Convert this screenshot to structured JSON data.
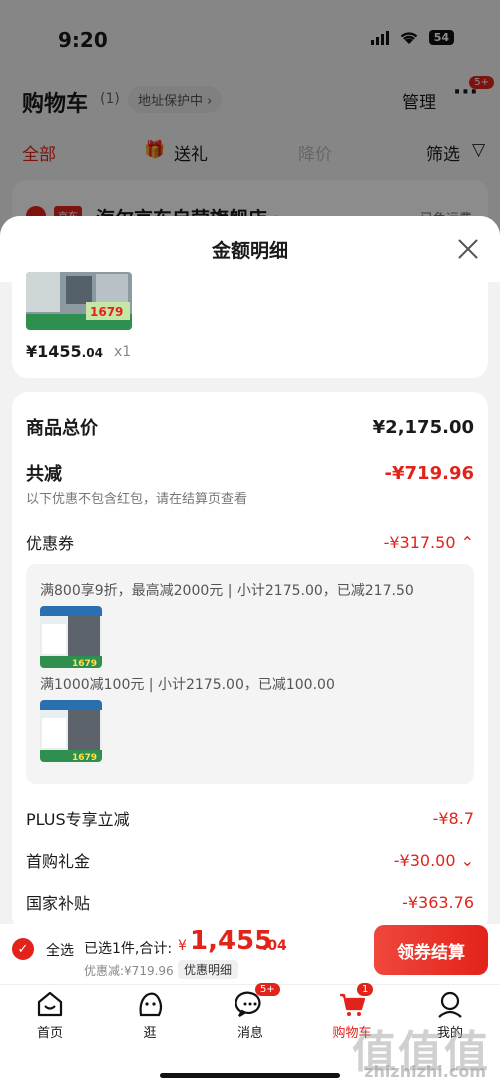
{
  "status_bar": {
    "time": "9:20",
    "battery": "54"
  },
  "background_page": {
    "title": "购物车",
    "count": "(1)",
    "address_protect": "地址保护中 ›",
    "manage": "管理",
    "more": "···",
    "more_badge": "5+",
    "tabs": {
      "all": "全部",
      "gift": "送礼",
      "discount": "降价",
      "filter": "筛选"
    },
    "store_tag": "京东",
    "store_name": "海尔京东自营旗舰店 ›",
    "shipping": "已免运费"
  },
  "sheet": {
    "title": "金额明细",
    "product": {
      "price_main": "¥1455",
      "price_dec": ".04",
      "qty": "x1"
    },
    "rows": {
      "total_label": "商品总价",
      "total_value": "¥2,175.00",
      "reduce_label": "共减",
      "reduce_value": "-¥719.96",
      "reduce_note": "以下优惠不包含红包，请在结算页查看",
      "coupon_label": "优惠券",
      "coupon_value": "-¥317.50 ⌃",
      "plus_label": "PLUS专享立减",
      "plus_value": "-¥8.7",
      "first_label": "首购礼金",
      "first_value": "-¥30.00 ⌄",
      "subsidy_label": "国家补贴",
      "subsidy_value": "-¥363.76"
    },
    "coupons": [
      {
        "text": "满800享9折，最高减2000元 | 小计2175.00，已减217.50"
      },
      {
        "text": "满1000减100元 | 小计2175.00，已减100.00"
      }
    ],
    "product_image_price": "1679"
  },
  "checkout": {
    "select_all": "全选",
    "selected": "已选1件,合计:",
    "yen": "¥",
    "total": "1,455",
    "total_dec": ".04",
    "saved": "优惠减:¥719.96",
    "detail_label": "优惠明细",
    "button": "领券结算"
  },
  "tabbar": {
    "home": "首页",
    "browse": "逛",
    "messages": "消息",
    "messages_badge": "5+",
    "cart": "购物车",
    "cart_badge": "1",
    "me": "我的"
  },
  "watermark": {
    "mark": "值值值",
    "url": "zhizhizhi.com"
  },
  "colors": {
    "accent": "#e2231a",
    "bg": "#f2f2f2"
  }
}
